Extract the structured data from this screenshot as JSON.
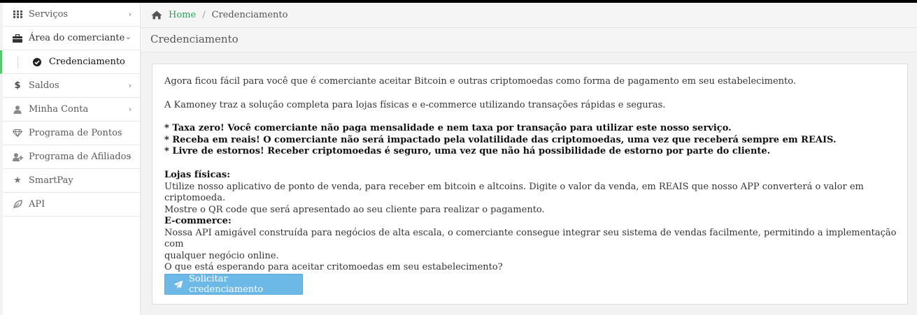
{
  "sidebar": {
    "items": [
      {
        "label": "Serviços",
        "icon": "grid-icon",
        "chevron": "›"
      },
      {
        "label": "Área do comerciante",
        "icon": "briefcase-icon",
        "chevron": "⌄"
      },
      {
        "label": "Credenciamento",
        "icon": "check-circle-icon",
        "active": true
      },
      {
        "label": "Saldos",
        "icon": "dollar-icon",
        "chevron": "›"
      },
      {
        "label": "Minha Conta",
        "icon": "user-icon",
        "chevron": "›"
      },
      {
        "label": "Programa de Pontos",
        "icon": "diamond-icon"
      },
      {
        "label": "Programa de Afiliados",
        "icon": "user-plus-icon",
        "chevron": "›"
      },
      {
        "label": "SmartPay",
        "icon": "star-icon"
      },
      {
        "label": "API",
        "icon": "leaf-icon"
      }
    ],
    "active_color": "#4cd067"
  },
  "breadcrumb": {
    "home": "Home",
    "separator": "/",
    "current": "Credenciamento"
  },
  "page": {
    "title": "Credenciamento"
  },
  "content": {
    "intro1": "Agora ficou fácil para você que é comerciante aceitar Bitcoin e outras criptomoedas como forma de pagamento em seu estabelecimento.",
    "intro2": "A Kamoney traz a solução completa para lojas físicas e e-commerce utilizando transações rápidas e seguras.",
    "bullet1": "* Taxa zero! Você comerciante não paga mensalidade e nem taxa por transação para utilizar este nosso serviço.",
    "bullet2": "* Receba em reais! O comerciante não será impactado pela volatilidade das criptomoedas, uma vez que receberá sempre em REAIS.",
    "bullet3": "* Livre de estornos! Receber criptomoedas é seguro, uma vez que não há possibilidade de estorno por parte do cliente.",
    "lojas_title": "Lojas físicas:",
    "lojas_line1": "Utilize nosso aplicativo de ponto de venda, para receber em bitcoin e altcoins. Digite o valor da venda, em REAIS que nosso APP converterá o valor em criptomoeda.",
    "lojas_line2": "Mostre o QR code que será apresentado ao seu cliente para realizar o pagamento.",
    "ecom_title": "E-commerce:",
    "ecom_line1": "Nossa API amigável construída para negócios de alta escala, o comerciante consegue integrar seu sistema de vendas facilmente, permitindo a implementação com",
    "ecom_line2": "qualquer negócio online.",
    "ecom_line3": "O que está esperando para aceitar critomoedas em seu estabelecimento?",
    "button_label": "Solicitar credenciamento",
    "button_color": "#6cb8e6",
    "link_color": "#2f9e5d"
  }
}
